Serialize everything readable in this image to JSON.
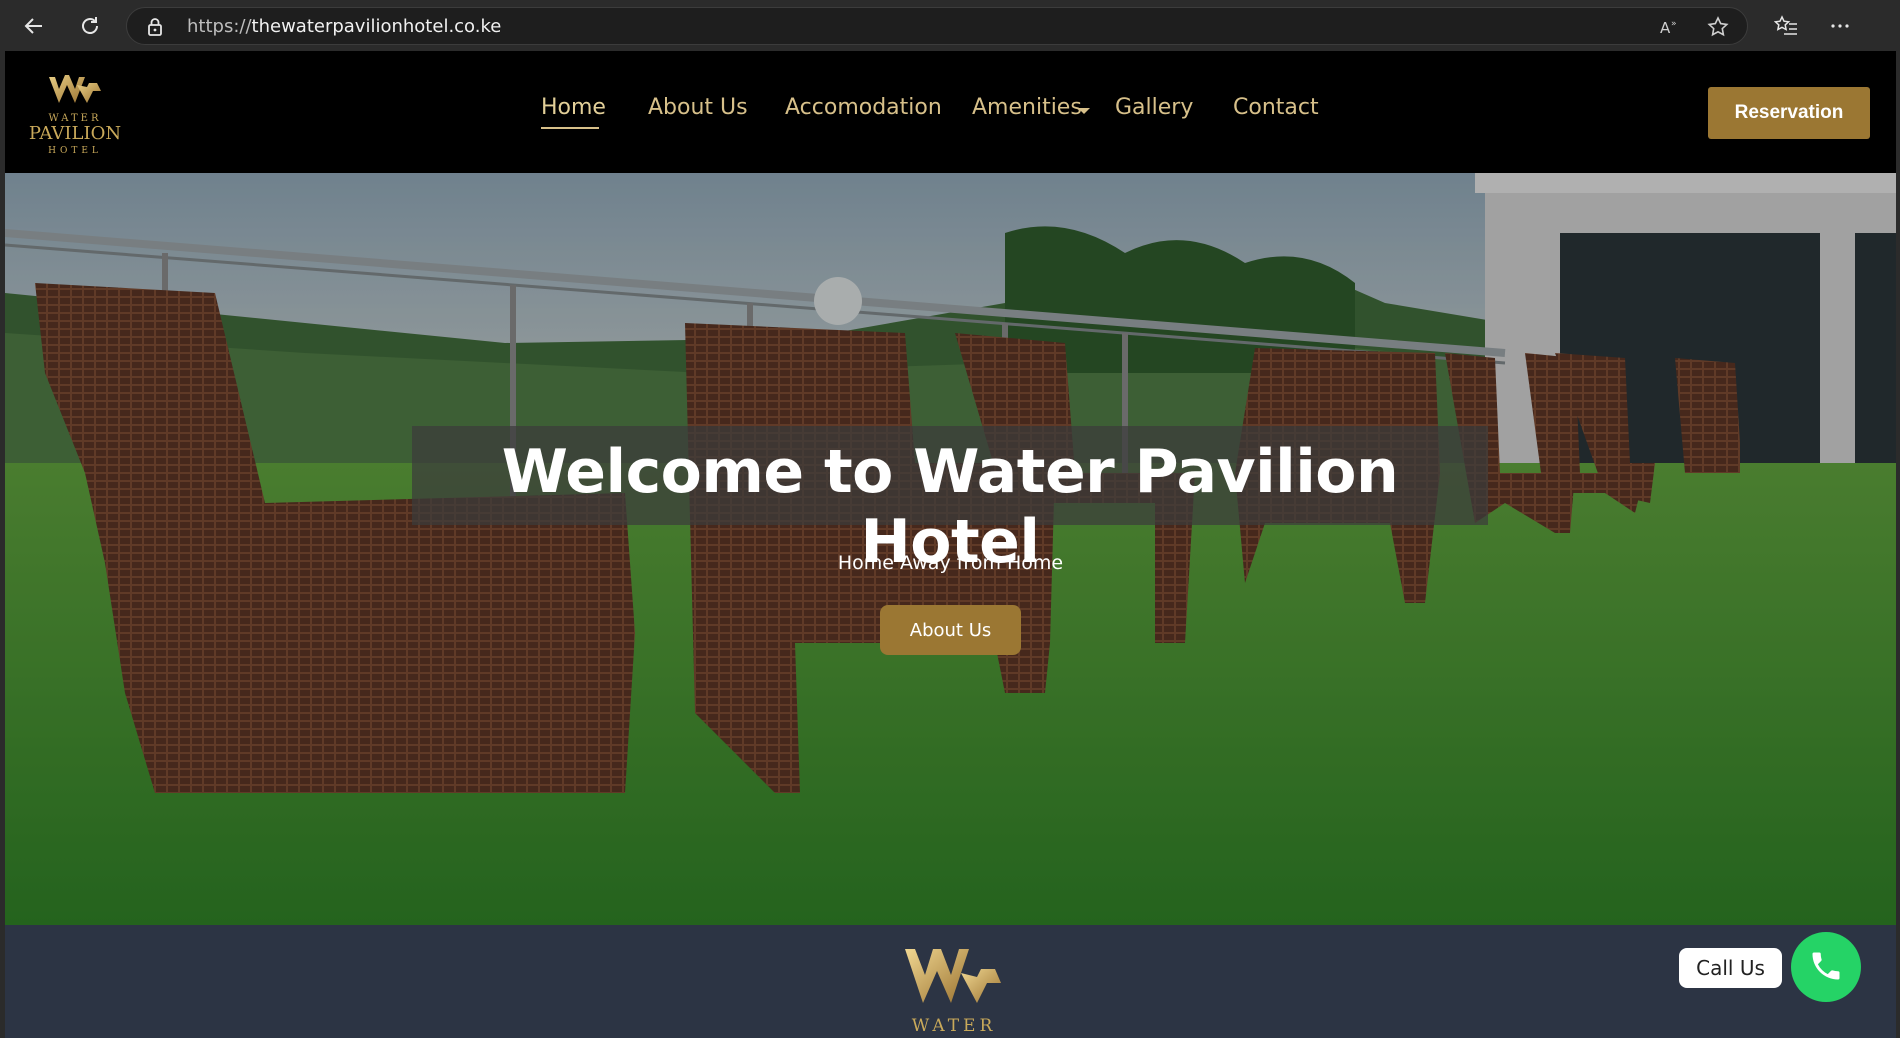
{
  "browser": {
    "url_prefix": "https://",
    "url_host": "thewaterpavilionhotel.co.ke",
    "icons": [
      "back-icon",
      "reload-icon",
      "lock-icon",
      "read-aloud-icon",
      "favorite-star-icon",
      "favorites-list-icon",
      "more-icon"
    ]
  },
  "nav": {
    "logo": {
      "line1": "WATER",
      "line2": "PAVILION",
      "line3": "HOTEL"
    },
    "items": [
      {
        "label": "Home",
        "active": true
      },
      {
        "label": "About Us"
      },
      {
        "label": "Accomodation"
      },
      {
        "label": "Amenities",
        "has_dropdown": true
      },
      {
        "label": "Gallery"
      },
      {
        "label": "Contact"
      }
    ],
    "cta": "Reservation"
  },
  "hero": {
    "title": "Welcome to Water Pavilion Hotel",
    "subtitle": "Home Away from Home",
    "button": "About Us"
  },
  "footer": {
    "logo_text": "WATER"
  },
  "call": {
    "label": "Call Us",
    "icon": "phone-icon"
  },
  "colors": {
    "gold": "#9b7733",
    "nav_text": "#d7c08a",
    "footer_bg": "#2c3444",
    "whatsapp_green": "#25d366"
  }
}
